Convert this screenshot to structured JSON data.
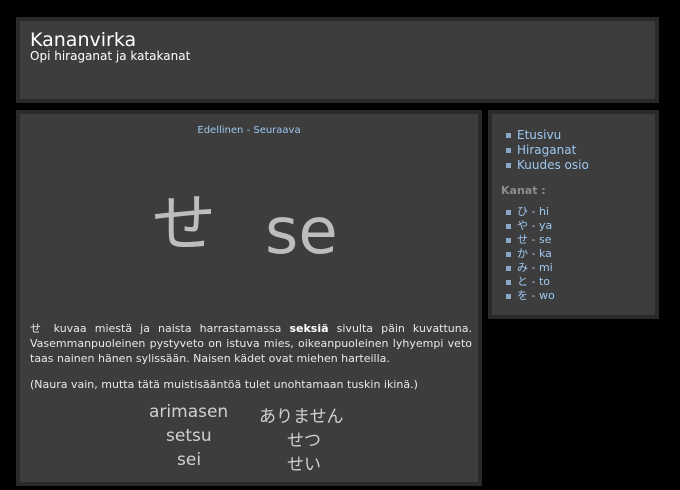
{
  "header": {
    "title": "Kananvirka",
    "subtitle": "Opi hiraganat ja katakanat"
  },
  "pager": {
    "previous": "Edellinen",
    "separator": " - ",
    "next": "Seuraava"
  },
  "lesson": {
    "kana": "せ",
    "romaji": "se",
    "description_parts": [
      "せ kuvaa miestä ja naista harrastamassa ",
      "seksiä",
      " sivulta päin kuvattuna. Vasemmanpuoleinen pystyveto on istuva mies, oikeanpuoleinen lyhyempi veto taas nainen hänen sylissään. Naisen kädet ovat miehen harteilla."
    ],
    "note": "(Naura vain, mutta tätä muistisääntöä tulet unohtamaan tuskin ikinä.)",
    "examples": [
      {
        "romaji": "arimasen",
        "kana": "ありません"
      },
      {
        "romaji": "setsu",
        "kana": "せつ"
      },
      {
        "romaji": "sei",
        "kana": "せい"
      }
    ]
  },
  "sidebar": {
    "nav": [
      "Etusivu",
      "Hiraganat",
      "Kuudes osio"
    ],
    "kana_heading": "Kanat :",
    "kana_links": [
      "ひ - hi",
      "や - ya",
      "せ - se",
      "か - ka",
      "み - mi",
      "と - to",
      "を - wo"
    ]
  },
  "colors": {
    "background": "#000000",
    "panel": "#3d3d3d",
    "panel_border": "#2a2a2a",
    "link": "#9ec8f0"
  }
}
